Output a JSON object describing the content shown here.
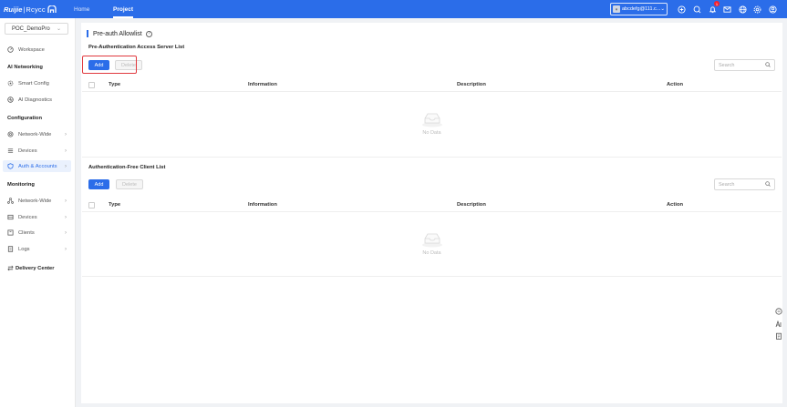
{
  "topbar": {
    "logo_brand": "Ruijie",
    "logo_sep": "|",
    "logo_product": "Rcycc",
    "nav_home": "Home",
    "nav_project": "Project",
    "account_label": "abcdefg@111.c...",
    "notification_count": "1",
    "icons": [
      "plus-circle-icon",
      "search-icon",
      "bell-icon",
      "message-icon",
      "globe-icon",
      "settings-icon",
      "user-icon"
    ],
    "bg_color": "#2b6de9"
  },
  "sidebar": {
    "project_select": "POC_DemoPro",
    "workspace": "Workspace",
    "section_ai": "AI Networking",
    "smart_config": "Smart Config",
    "ai_diagnostics": "AI Diagnostics",
    "section_config": "Configuration",
    "config_network_wide": "Network-Wide",
    "config_devices": "Devices",
    "auth_accounts": "Auth & Accounts",
    "section_monitoring": "Monitoring",
    "mon_network_wide": "Network-Wide",
    "mon_devices": "Devices",
    "mon_clients": "Clients",
    "mon_logs": "Logs",
    "delivery_center": "Delivery Center"
  },
  "main": {
    "page_title": "Pre-auth Allowlist",
    "section1": {
      "title": "Pre-Authentication Access Server List",
      "add": "Add",
      "delete": "Delete",
      "search_placeholder": "Search",
      "columns": [
        "Type",
        "Information",
        "Description",
        "Action"
      ],
      "empty_text": "No Data"
    },
    "section2": {
      "title": "Authentication-Free Client List",
      "add": "Add",
      "delete": "Delete",
      "search_placeholder": "Search",
      "columns": [
        "Type",
        "Information",
        "Description",
        "Action"
      ],
      "empty_text": "No Data"
    }
  },
  "colors": {
    "accent": "#2b6de9",
    "highlight": "#e0393e"
  }
}
